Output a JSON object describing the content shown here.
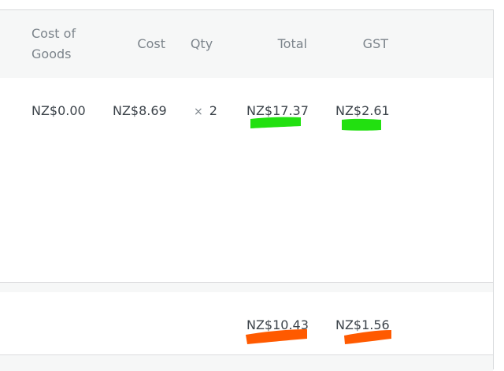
{
  "columns": {
    "cost_of_goods": "Cost of Goods",
    "cost": "Cost",
    "qty": "Qty",
    "total": "Total",
    "gst": "GST"
  },
  "item_row": {
    "cost_of_goods": "NZ$0.00",
    "cost": "NZ$8.69",
    "qty_symbol": "×",
    "qty": "2",
    "total": "NZ$17.37",
    "gst": "NZ$2.61"
  },
  "refund_row": {
    "total": "NZ$10.43",
    "gst": "NZ$1.56"
  },
  "highlight_colors": {
    "item_row": "#22e010",
    "refund_row": "#ff5a00"
  }
}
